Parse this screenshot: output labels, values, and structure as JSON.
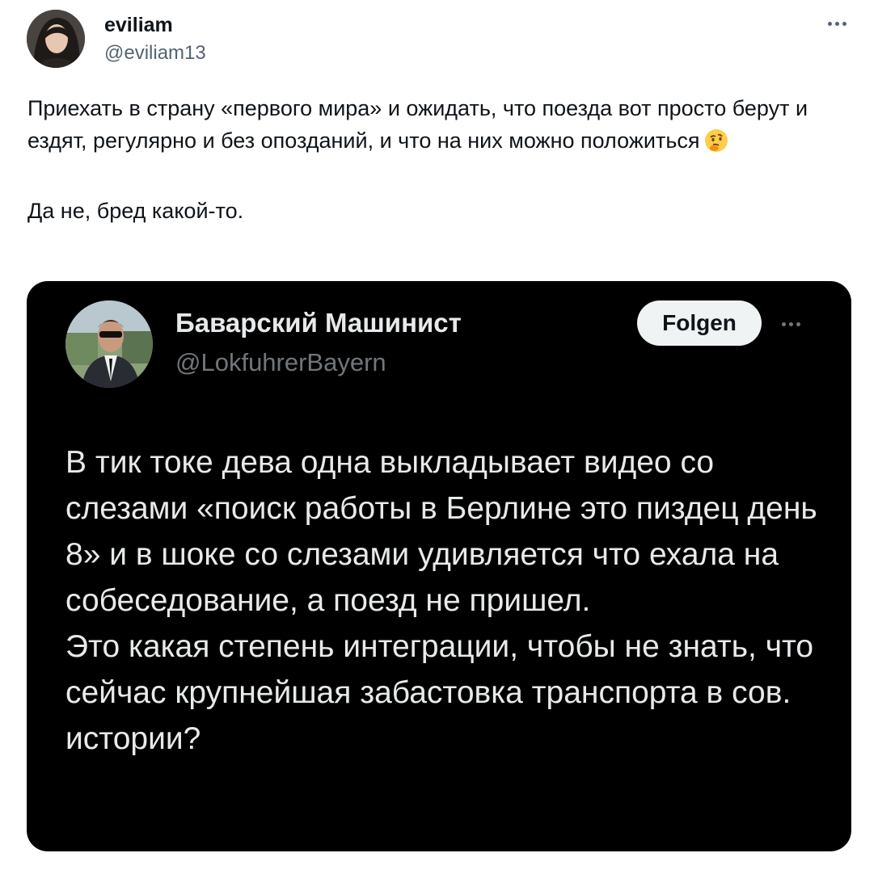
{
  "tweet": {
    "author_name": "eviliam",
    "author_handle": "@eviliam13",
    "avatar_icon": "user-avatar",
    "more_icon": "more-horizontal-icon",
    "text_line": "Приехать в страну «первого мира» и ожидать, что поезда вот просто берут и ездят, регулярно и без опозданий, и что на них можно положиться",
    "emoji_icon": "thinking-face-emoji",
    "text_para2": "Да не, бред какой-то."
  },
  "quoted_card": {
    "author_name": "Баварский Машинист",
    "author_handle": "@LokfuhrerBayern",
    "avatar_icon": "user-avatar",
    "follow_label": "Folgen",
    "more_icon": "more-horizontal-icon",
    "background": "#000000",
    "text": "В тик токе дева одна выкладывает видео со слезами «поиск работы в Берлине это пиздец день 8» и в шоке со слезами удивляется что ехала на собеседование, а поезд не пришел.\nЭто какая степень интеграции, чтобы не знать, что сейчас крупнейшая забастовка транспорта в сов. истории?"
  }
}
